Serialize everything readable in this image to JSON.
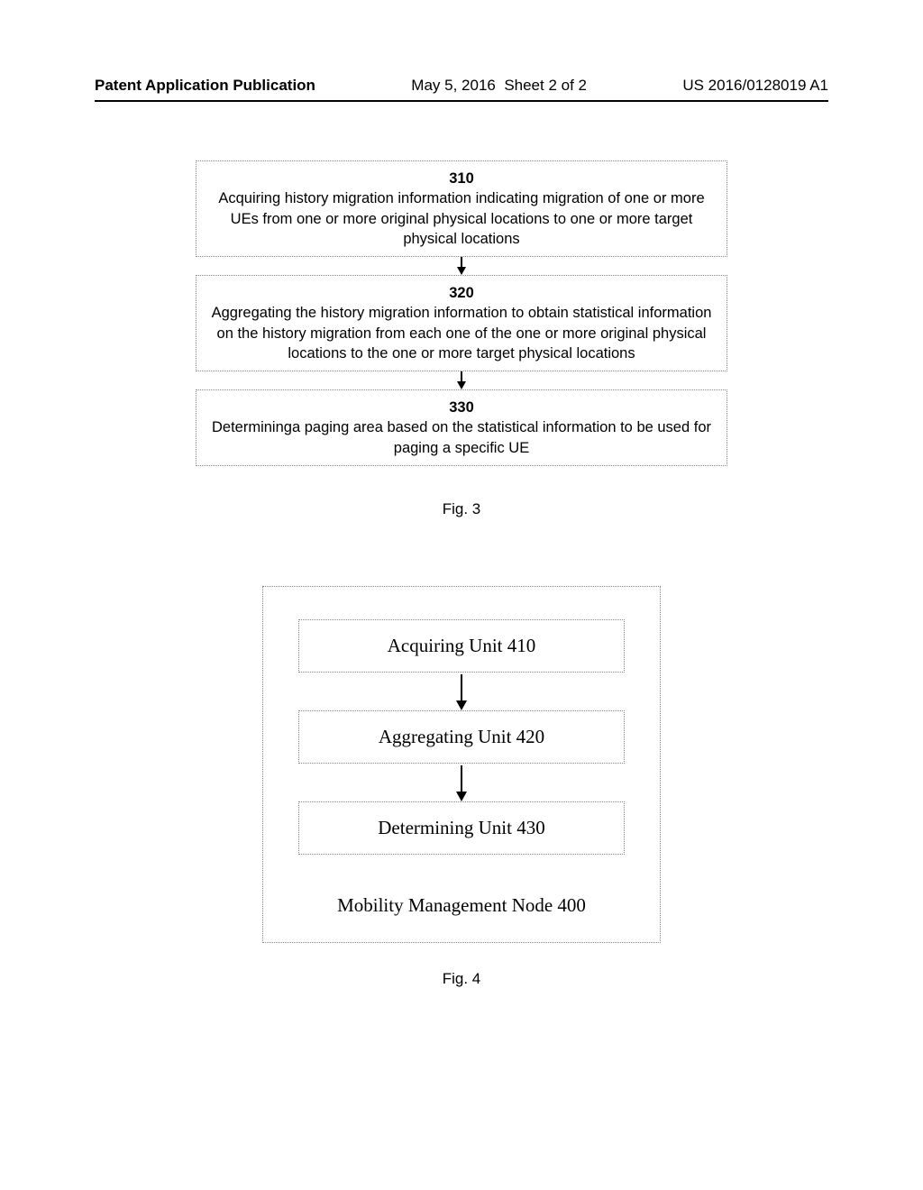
{
  "header": {
    "pub_line": "Patent Application Publication",
    "date": "May 5, 2016",
    "sheet": "Sheet 2 of 2",
    "pub_no": "US 2016/0128019 A1"
  },
  "fig3": {
    "box1": {
      "num": "310",
      "text": "Acquiring history migration information indicating migration of one or more UEs from one or more original physical locations to one or more target physical locations"
    },
    "box2": {
      "num": "320",
      "text": "Aggregating the history migration information to obtain statistical information on the history migration from each one of the one or more original physical locations to the one or more target physical locations"
    },
    "box3": {
      "num": "330",
      "text": "Determininga paging area based on the statistical information to be used for paging a specific UE"
    },
    "caption": "Fig. 3"
  },
  "fig4": {
    "unit1": "Acquiring Unit 410",
    "unit2": "Aggregating Unit 420",
    "unit3": "Determining Unit 430",
    "node_label": "Mobility Management Node 400",
    "caption": "Fig. 4"
  }
}
